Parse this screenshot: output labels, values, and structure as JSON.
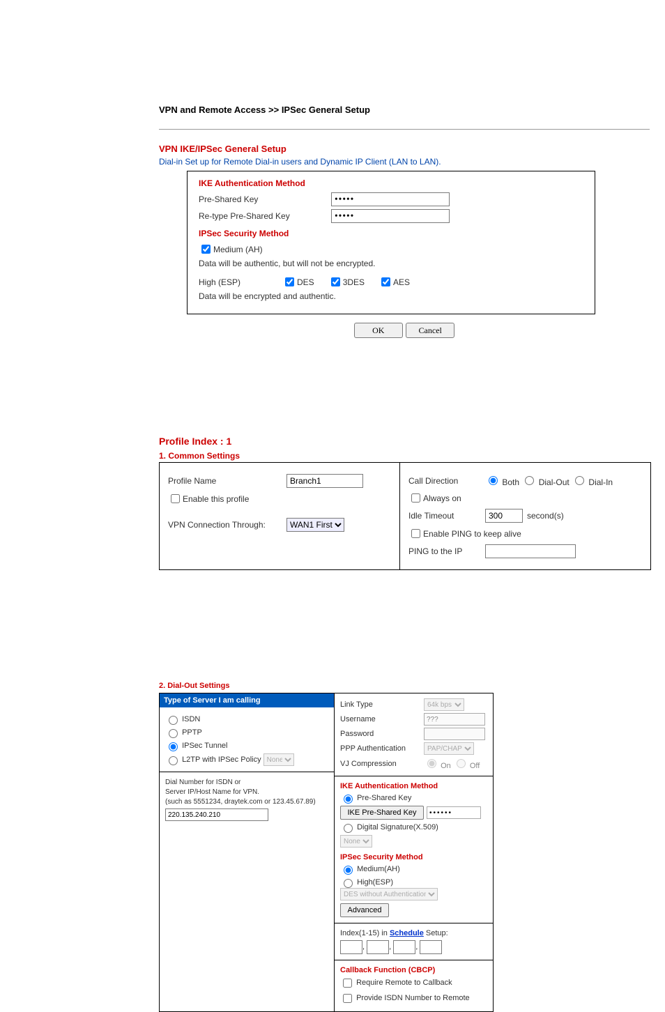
{
  "page": {
    "breadcrumb": "VPN and Remote Access >> IPSec General Setup"
  },
  "ipsec_general": {
    "heading": "VPN IKE/IPSec General Setup",
    "desc": "Dial-in Set up for Remote Dial-in users and Dynamic IP Client (LAN to LAN).",
    "ike_auth_hdr": "IKE Authentication Method",
    "psk_label": "Pre-Shared Key",
    "psk_value": "•••••",
    "repsk_label": "Re-type Pre-Shared Key",
    "repsk_value": "•••••",
    "sec_method_hdr": "IPSec Security Method",
    "medium_label": "Medium (AH)",
    "medium_desc": "Data will be authentic, but will not be encrypted.",
    "high_label": "High (ESP)",
    "des": "DES",
    "tdes": "3DES",
    "aes": "AES",
    "high_desc": "Data will be encrypted and authentic.",
    "ok": "OK",
    "cancel": "Cancel"
  },
  "profile": {
    "idx_title": "Profile Index : 1",
    "common_hdr": "1. Common Settings",
    "name_lbl": "Profile Name",
    "name_val": "Branch1",
    "enable_lbl": "Enable this profile",
    "vpn_thru_lbl": "VPN Connection Through:",
    "vpn_thru_val": "WAN1 First",
    "call_dir_lbl": "Call Direction",
    "both": "Both",
    "dialout": "Dial-Out",
    "dialin": "Dial-In",
    "always_on": "Always on",
    "idle_lbl": "Idle Timeout",
    "idle_val": "300",
    "idle_unit": "second(s)",
    "ping_lbl": "Enable PING to keep alive",
    "ping_ip_lbl": "PING to the IP"
  },
  "dialout": {
    "hdr": "2. Dial-Out Settings",
    "type_hdr": "Type of Server I am calling",
    "isdn": "ISDN",
    "pptp": "PPTP",
    "ipsec": "IPSec Tunnel",
    "l2tp": "L2TP with IPSec Policy",
    "l2tp_sel": "None",
    "srv_desc1": "Dial Number for ISDN or",
    "srv_desc2": "Server IP/Host Name for VPN.",
    "srv_desc3": "(such as 5551234, draytek.com or 123.45.67.89)",
    "srv_val": "220.135.240.210",
    "link_type_lbl": "Link Type",
    "link_type_val": "64k bps",
    "user_lbl": "Username",
    "user_val": "???",
    "pass_lbl": "Password",
    "ppp_auth_lbl": "PPP Authentication",
    "ppp_auth_val": "PAP/CHAP",
    "vj_lbl": "VJ Compression",
    "on": "On",
    "off": "Off",
    "ike_auth_hdr": "IKE Authentication Method",
    "psk_radio": "Pre-Shared Key",
    "psk_btn": "IKE Pre-Shared Key",
    "psk_dots": "••••••",
    "dsig": "Digital Signature(X.509)",
    "dsig_sel": "None",
    "sec_hdr": "IPSec Security Method",
    "medium": "Medium(AH)",
    "high": "High(ESP)",
    "high_sel": "DES without Authentication",
    "advanced": "Advanced",
    "sched_lbl_pre": "Index(1-15) in ",
    "sched_link": "Schedule",
    "sched_lbl_post": " Setup:",
    "cbcp_hdr": "Callback Function (CBCP)",
    "cbcp1": "Require Remote to Callback",
    "cbcp2": "Provide ISDN Number to Remote"
  }
}
